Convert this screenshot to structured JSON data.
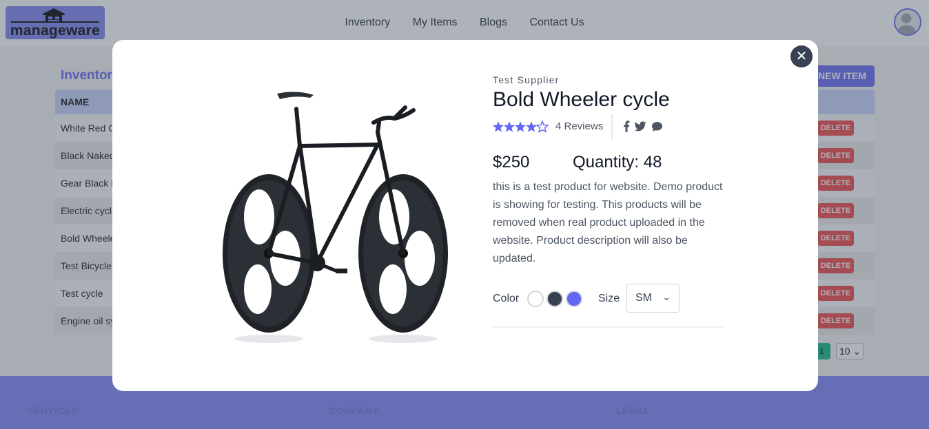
{
  "header": {
    "logo_text": "manageware",
    "nav": [
      "Inventory",
      "My Items",
      "Blogs",
      "Contact Us"
    ]
  },
  "inventory": {
    "title": "Inventory",
    "new_item_label": "NEW ITEM",
    "column_name": "NAME",
    "rows": [
      {
        "name": "White Red G",
        "action": "DELETE"
      },
      {
        "name": "Black Naked",
        "action": "DELETE"
      },
      {
        "name": "Gear Black N",
        "action": "DELETE"
      },
      {
        "name": "Electric cycle",
        "action": "DELETE"
      },
      {
        "name": "Bold Wheele",
        "action": "DELETE"
      },
      {
        "name": "Test Bicycle",
        "action": "DELETE"
      },
      {
        "name": "Test cycle",
        "action": "DELETE"
      },
      {
        "name": "Engine oil sy",
        "action": "DELETE"
      }
    ],
    "page": "1",
    "per_page": "10"
  },
  "footer": {
    "columns": [
      "SERVICES",
      "COMPANY",
      "LEGAL"
    ]
  },
  "modal": {
    "close_icon": "close-icon",
    "supplier": "Test Supplier",
    "title": "Bold Wheeler cycle",
    "rating": 4,
    "rating_max": 5,
    "reviews": "4 Reviews",
    "price": "$250",
    "quantity": "Quantity: 48",
    "description": "this is a test product for website. Demo product is showing for testing. This products will be removed when real product uploaded in the website. Product description will also be updated.",
    "color_label": "Color",
    "colors": [
      "#ffffff",
      "#374151",
      "#6366f1"
    ],
    "size_label": "Size",
    "size_value": "SM",
    "social_icons": [
      "facebook-icon",
      "twitter-icon",
      "chat-icon"
    ]
  },
  "colors": {
    "accent": "#6366f1",
    "delete": "#ef4444",
    "footer": "#7c83fa",
    "pager": "#10b981"
  }
}
